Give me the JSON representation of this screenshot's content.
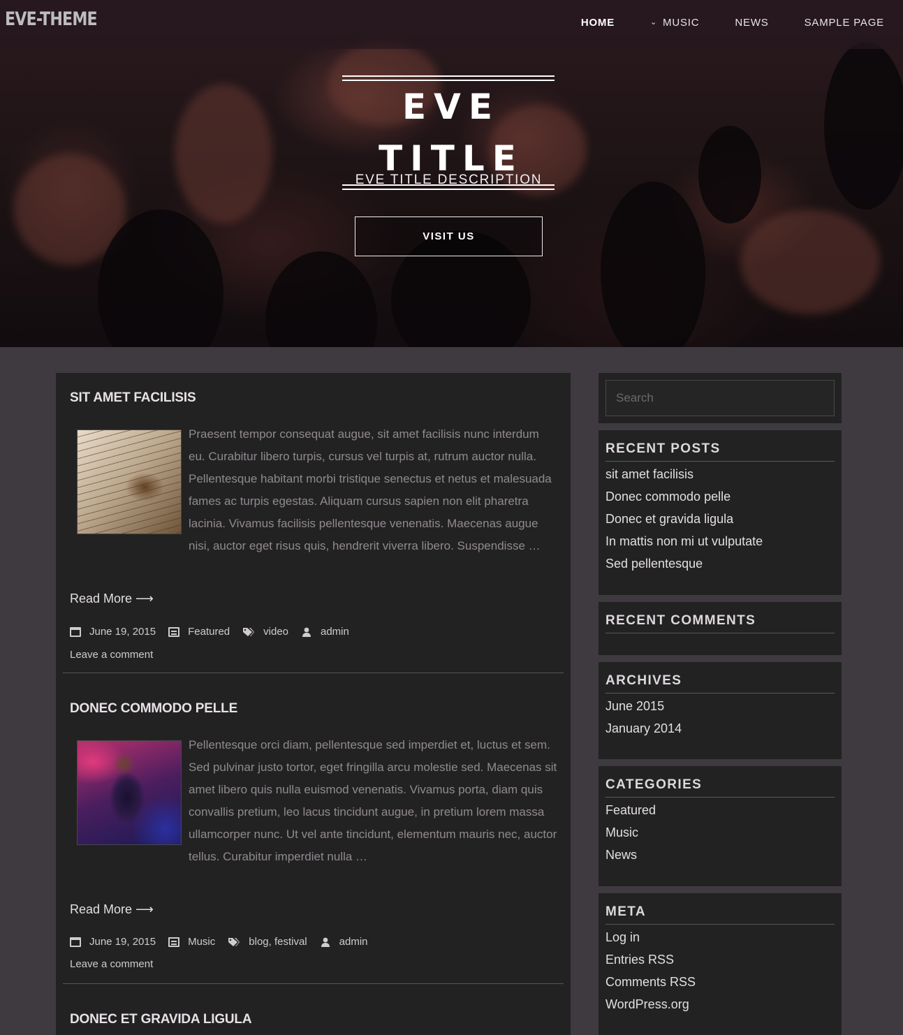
{
  "site": {
    "logo": "EVE-THEME",
    "nav": [
      {
        "label": "HOME",
        "active": true
      },
      {
        "label": "MUSIC",
        "has_submenu": true
      },
      {
        "label": "NEWS"
      },
      {
        "label": "SAMPLE PAGE"
      }
    ]
  },
  "hero": {
    "title": "EVE TITLE",
    "description": "EVE TITLE DESCRIPTION",
    "button": "VISIT US"
  },
  "posts": [
    {
      "title": "SIT AMET FACILISIS",
      "thumbnail": "violin-sheet-music-image",
      "excerpt": "Praesent tempor consequat augue, sit amet facilisis nunc interdum eu. Curabitur libero turpis, cursus vel turpis at, rutrum auctor nulla. Pellentesque habitant morbi tristique senectus et netus et malesuada fames ac turpis egestas. Aliquam cursus sapien non elit pharetra lacinia. Vivamus facilisis pellentesque venenatis. Maecenas augue nisi, auctor eget risus quis, hendrerit viverra libero. Suspendisse …",
      "read_more": "Read More ⟶",
      "date": "June 19, 2015",
      "category": "Featured",
      "tags": "video",
      "author": "admin",
      "comment_link": "Leave a comment"
    },
    {
      "title": "DONEC COMMODO PELLE",
      "thumbnail": "guitarist-concert-image",
      "excerpt": "Pellentesque orci diam, pellentesque sed imperdiet et, luctus et sem. Sed pulvinar justo tortor, eget fringilla arcu molestie sed. Maecenas sit amet libero quis nulla euismod venenatis. Vivamus porta, diam quis convallis pretium, leo lacus tincidunt augue, in pretium lorem massa ullamcorper nunc. Ut vel ante tincidunt, elementum mauris nec, auctor tellus. Curabitur imperdiet nulla …",
      "read_more": "Read More ⟶",
      "date": "June 19, 2015",
      "category": "Music",
      "tags": "blog, festival",
      "author": "admin",
      "comment_link": "Leave a comment"
    },
    {
      "title": "DONEC ET GRAVIDA LIGULA"
    }
  ],
  "sidebar": {
    "search_placeholder": "Search",
    "recent_posts": {
      "title": "RECENT POSTS",
      "items": [
        "sit amet facilisis",
        "Donec commodo pelle",
        "Donec et gravida ligula",
        "In mattis non mi ut vulputate",
        "Sed pellentesque"
      ]
    },
    "recent_comments": {
      "title": "RECENT COMMENTS"
    },
    "archives": {
      "title": "ARCHIVES",
      "items": [
        "June 2015",
        "January 2014"
      ]
    },
    "categories": {
      "title": "CATEGORIES",
      "items": [
        "Featured",
        "Music",
        "News"
      ]
    },
    "meta": {
      "title": "META",
      "items": [
        "Log in",
        "Entries RSS",
        "Comments RSS",
        "WordPress.org"
      ]
    }
  },
  "colors": {
    "page_bg": "#3e3a40",
    "panel_bg": "#232223",
    "text_muted": "#8f8a8f",
    "text_light": "#e2dee2"
  }
}
